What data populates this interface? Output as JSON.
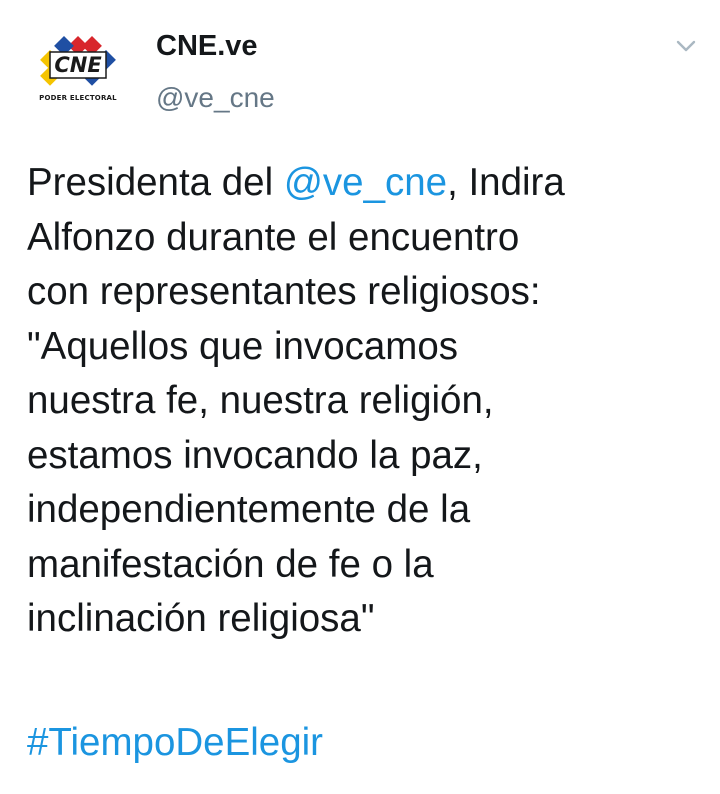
{
  "account": {
    "display_name": "CNE.ve",
    "handle": "@ve_cne",
    "logo_text": "CNE",
    "logo_caption": "PODER ELECTORAL"
  },
  "menu": {
    "icon": "chevron-down-icon"
  },
  "tweet": {
    "lines": [
      {
        "before": "Presidenta del ",
        "mention": "@ve_cne",
        "after": ", Indira"
      },
      {
        "text": "Alfonzo durante el encuentro"
      },
      {
        "text": "con representantes religiosos:"
      },
      {
        "text": "\"Aquellos que invocamos"
      },
      {
        "text": "nuestra fe, nuestra religión,"
      },
      {
        "text": "estamos invocando la paz,"
      },
      {
        "text": "independientemente de la"
      },
      {
        "text": "manifestación de fe o la"
      },
      {
        "text": "inclinación religiosa\""
      }
    ],
    "hashtag": "#TiempoDeElegir"
  },
  "colors": {
    "link": "#1b95e0",
    "text": "#14171a",
    "secondary": "#657786",
    "logo_yellow": "#f5c400",
    "logo_blue": "#1f4fa3",
    "logo_red": "#d8262c"
  }
}
